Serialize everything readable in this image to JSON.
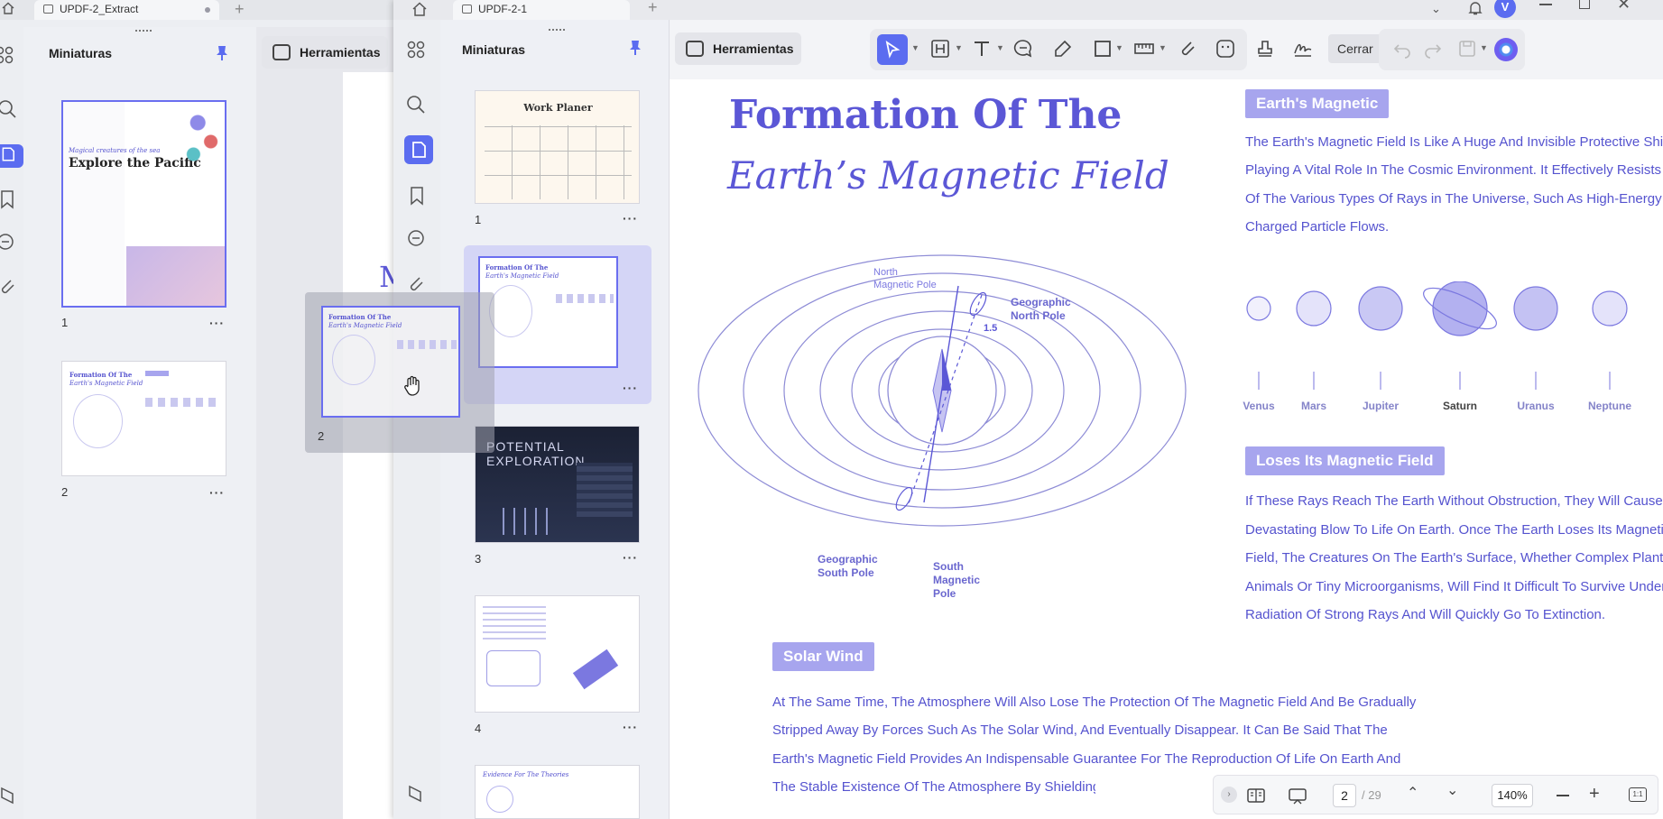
{
  "back_window": {
    "tab_title": "UPDF-2_Extract",
    "panel_title": "Miniaturas",
    "tools_label": "Herramientas",
    "thumbnails": [
      {
        "num": "1",
        "menu": "···",
        "tagline": "Magical creatures of the sea",
        "headline": "Explore the Pacific"
      },
      {
        "num": "2",
        "menu": "···",
        "title_a": "Formation Of The",
        "title_b": "Earth's Magnetic Field"
      }
    ],
    "partial_letter": "M"
  },
  "drag_ghost": {
    "num": "2",
    "menu": "···",
    "title_a": "Formation Of The",
    "title_b": "Earth's Magnetic Field"
  },
  "front_window": {
    "tab_title": "UPDF-2-1",
    "panel_title": "Miniaturas",
    "tools_label": "Herramientas",
    "close_label": "Cerrar",
    "avatar_letter": "V",
    "thumbnails": [
      {
        "num": "1",
        "menu": "···",
        "title": "Work Planer"
      },
      {
        "num": "2",
        "menu": "···",
        "title_a": "Formation Of The",
        "title_b": "Earth's Magnetic Field"
      },
      {
        "num": "3",
        "menu": "···",
        "title": "POTENTIAL EXPLORATION"
      },
      {
        "num": "4",
        "menu": "···"
      },
      {
        "title": "Evidence For The Theories"
      }
    ]
  },
  "document": {
    "title_line1": "Formation Of The",
    "title_line2": "Earth’s Magnetic Field",
    "diagram_labels": {
      "north_magnetic": "North\nMagnetic Pole",
      "geographic_north": "Geographic\nNorth Pole",
      "angle": "1.5",
      "geographic_south": "Geographic\nSouth Pole",
      "south_magnetic": "South\nMagnetic\nPole"
    },
    "section1_heading": "Earth's Magnetic",
    "section1_lines": [
      "The Earth's Magnetic Field Is Like A Huge And Invisible Protective Shie",
      "Playing A Vital Role In The Cosmic Environment. It Effectively Resists M",
      "Of The Various Types Of Rays in The Universe, Such As High-Energy",
      "Charged Particle Flows."
    ],
    "planets": [
      "Venus",
      "Mars",
      "Jupiter",
      "Saturn",
      "Uranus",
      "Neptune"
    ],
    "section2_heading": "Loses Its Magnetic Field",
    "section2_lines": [
      "If These Rays Reach The Earth Without Obstruction, They Will Cause A",
      "Devastating Blow To Life On Earth. Once The Earth Loses Its Magnetic",
      "Field, The Creatures On The Earth's Surface, Whether Complex Plants",
      "Animals Or Tiny Microorganisms, Will Find It Difficult To Survive Under",
      "Radiation Of Strong Rays And Will Quickly Go To Extinction."
    ],
    "section3_heading": "Solar Wind",
    "section3_lines": [
      "At The Same Time, The Atmosphere Will Also Lose The Protection Of The Magnetic Field And Be Gradually",
      "Stripped Away By Forces Such As The Solar Wind, And Eventually Disappear. It Can Be Said That The",
      "Earth's Magnetic Field Provides An Indispensable Guarantee For The Reproduction Of Life On Earth And",
      "The Stable Existence Of The Atmosphere By Shielding Dangerous Substances Suc"
    ]
  },
  "bottom_bar": {
    "page": "2",
    "total": "/ 29",
    "zoom": "140%"
  },
  "colors": {
    "accent": "#5b57d6",
    "section_bg": "#a7a5ee",
    "active_icon": "#5b6cf0"
  }
}
